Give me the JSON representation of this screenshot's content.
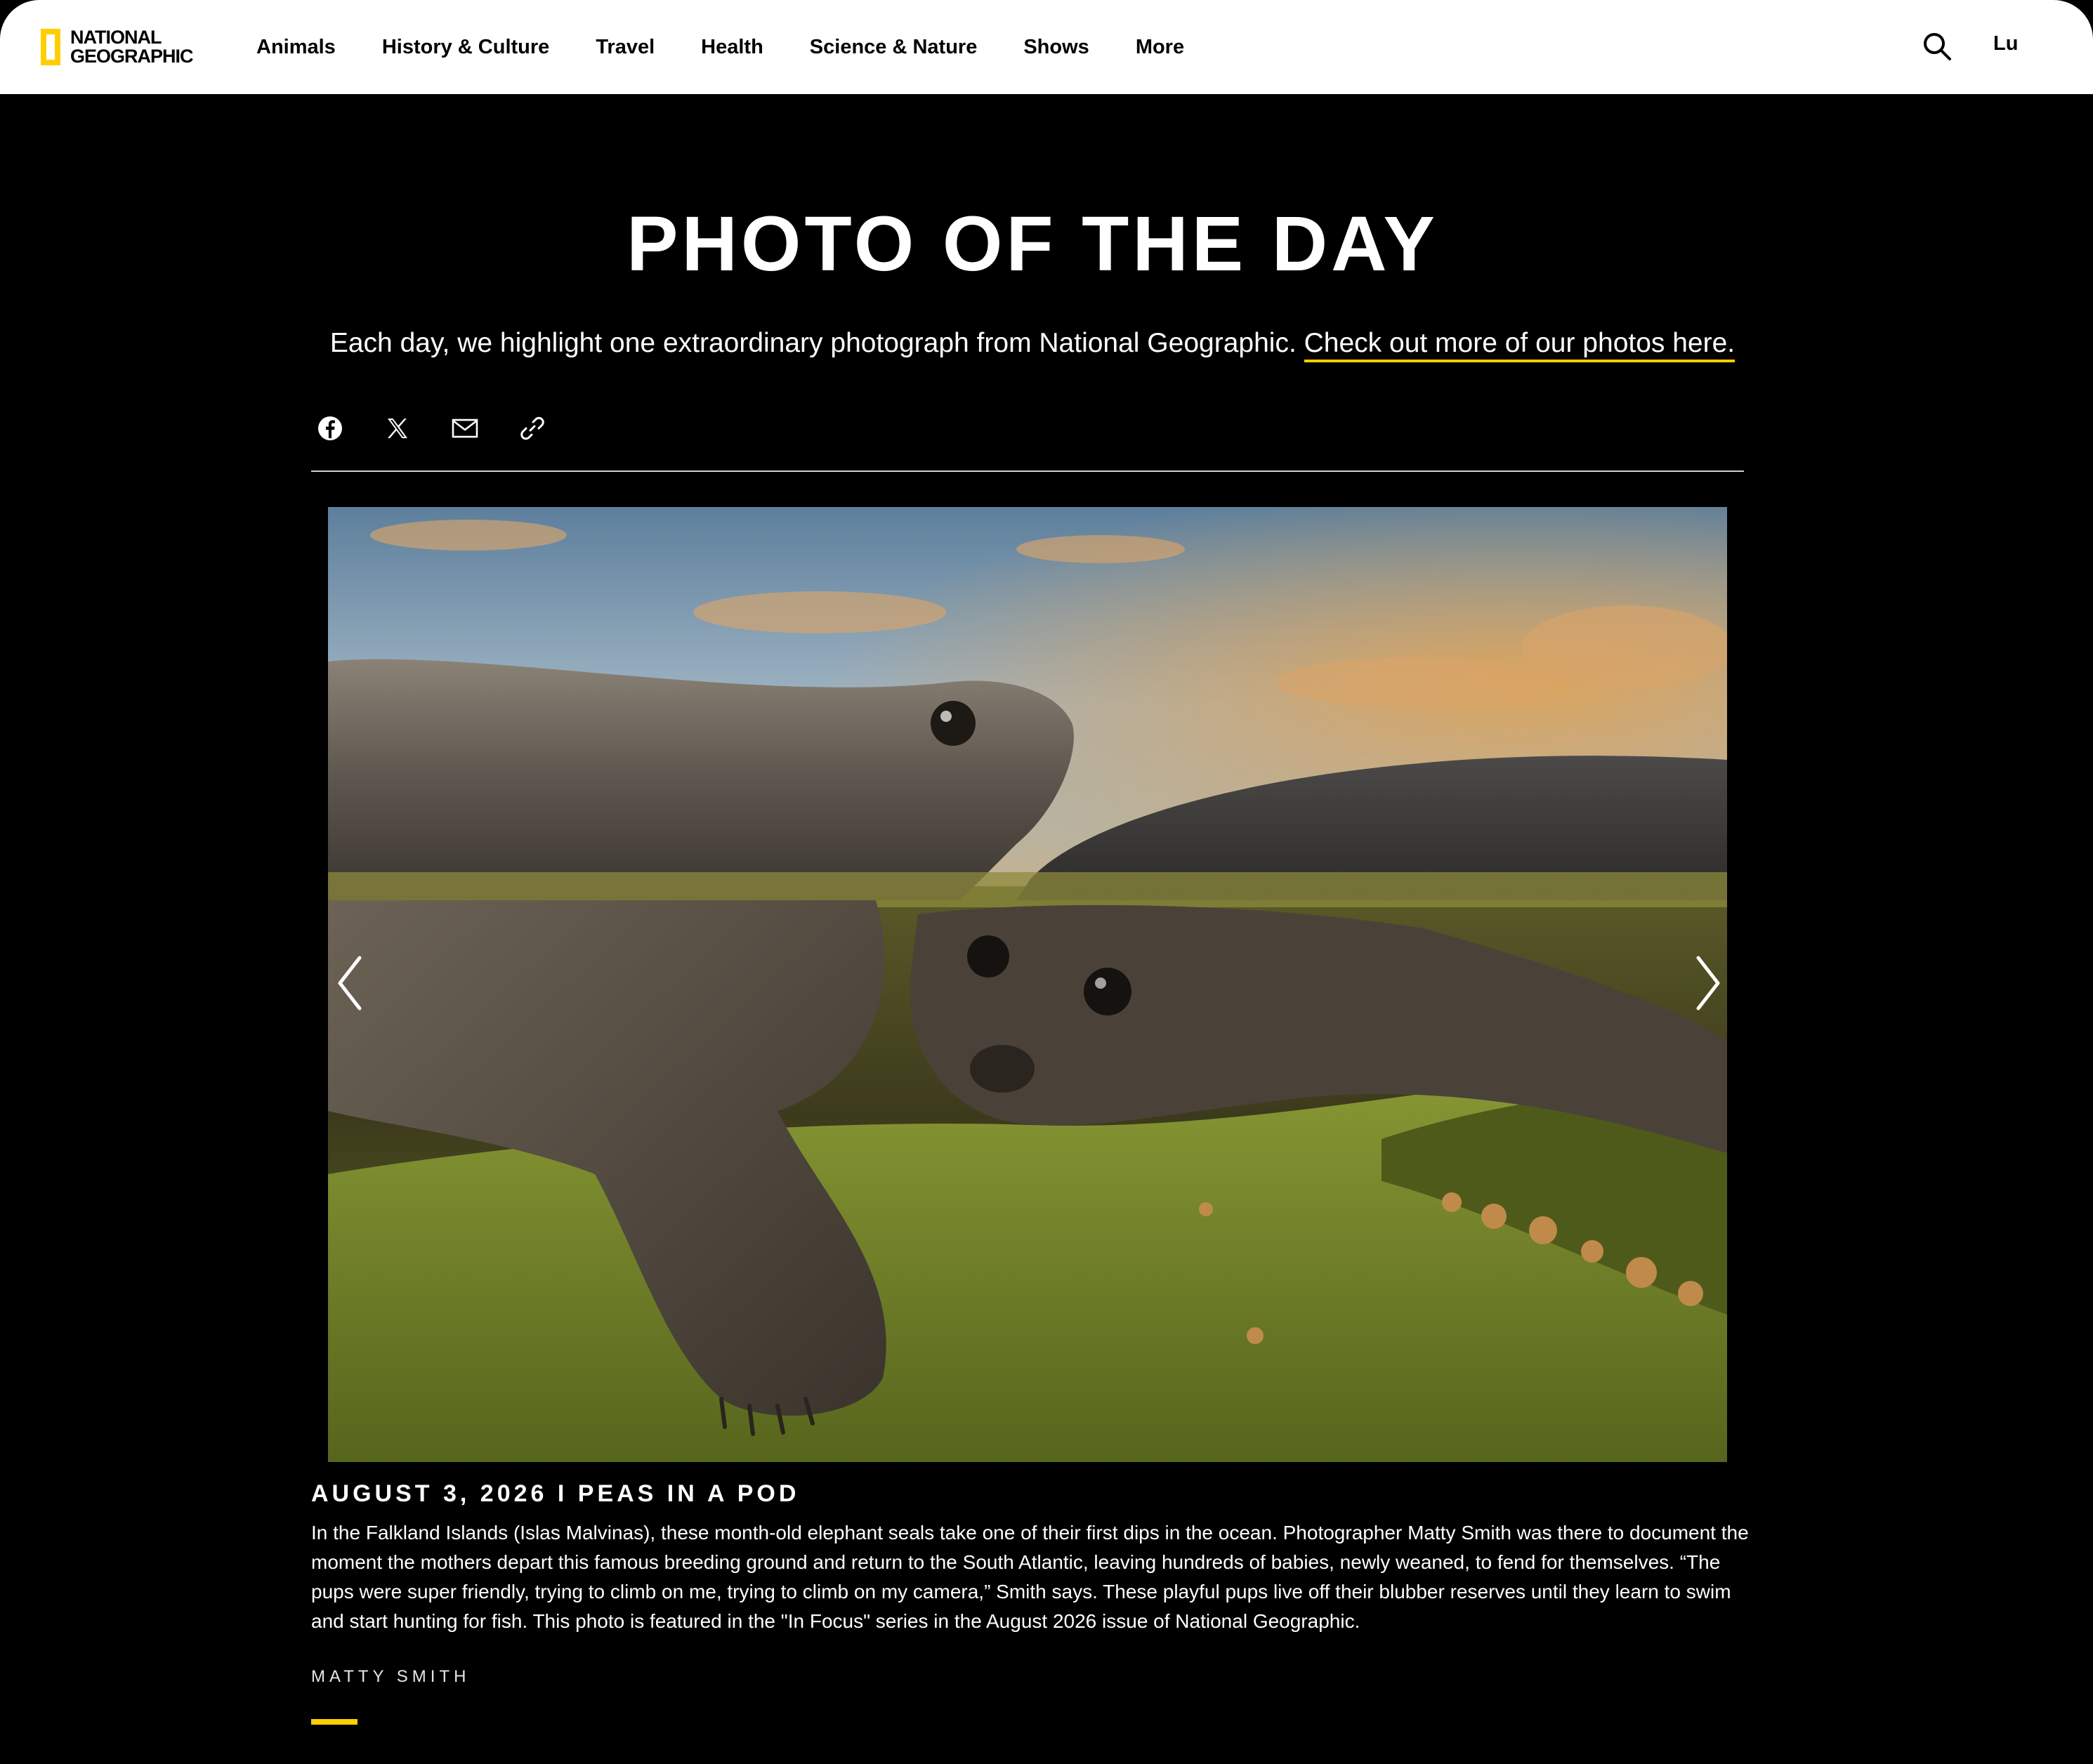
{
  "header": {
    "logo_line1": "NATIONAL",
    "logo_line2": "GEOGRAPHIC",
    "nav": [
      "Animals",
      "History & Culture",
      "Travel",
      "Health",
      "Science & Nature",
      "Shows",
      "More"
    ],
    "user_initials": "Lu",
    "brand_yellow": "#ffce00"
  },
  "page": {
    "title": "PHOTO OF THE DAY",
    "intro_text": "Each day, we highlight one extraordinary photograph from National Geographic.",
    "intro_link": "Check out more of our photos here."
  },
  "share": {
    "icons": [
      "facebook-icon",
      "x-icon",
      "email-icon",
      "link-icon"
    ]
  },
  "photo": {
    "description_icon": "photo-of-elephant-seal-pups",
    "prev_icon": "chevron-left-icon",
    "next_icon": "chevron-right-icon"
  },
  "caption": {
    "title": "AUGUST 3, 2026 I PEAS IN A POD",
    "body": "In the Falkland Islands (Islas Malvinas), these month-old elephant seals take one of their first dips in the ocean. Photographer Matty Smith was there to document the moment the mothers depart this famous breeding ground and return to the South Atlantic, leaving hundreds of babies, newly weaned, to fend for themselves. “The pups were super friendly, trying to climb on me, trying to climb on my camera,” Smith says. These playful pups live off their blubber reserves until they learn to swim and start hunting for fish. This photo is featured in the \"In Focus\" series in the August 2026 issue of National Geographic.",
    "credit": "MATTY SMITH"
  }
}
